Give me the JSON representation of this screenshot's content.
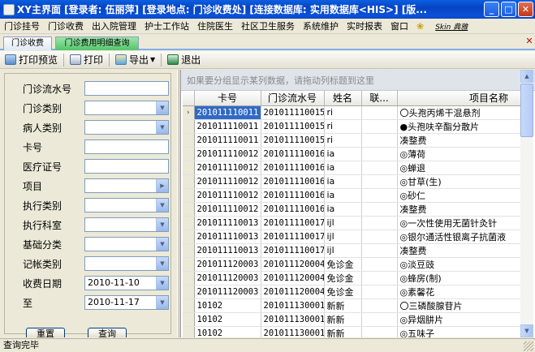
{
  "window": {
    "title": "XY主界面  [登录者: 伍丽萍]  [登录地点: 门诊收费处]  [连接数据库: 实用数据库<HIS>]  [版...",
    "minimize": "_",
    "maximize": "□",
    "close": "✕"
  },
  "menu": [
    "门诊挂号",
    "门诊收费",
    "出入院管理",
    "护士工作站",
    "住院医生",
    "社区卫生服务",
    "系统维护",
    "实时报表",
    "窗口"
  ],
  "menu_skin": "Skin 典雅",
  "tabs": [
    "门诊收费",
    "门诊费用明细查询"
  ],
  "tab_close": "✕",
  "toolbar": {
    "print_preview": "打印预览",
    "print": "打印",
    "export": "导出",
    "exit": "退出"
  },
  "filters": {
    "flow_no": {
      "label": "门诊流水号",
      "value": ""
    },
    "category": {
      "label": "门诊类别",
      "value": ""
    },
    "patient_type": {
      "label": "病人类别",
      "value": ""
    },
    "card_no": {
      "label": "卡号",
      "value": ""
    },
    "insurance_no": {
      "label": "医疗证号",
      "value": ""
    },
    "item": {
      "label": "项目",
      "value": ""
    },
    "exec_type": {
      "label": "执行类别",
      "value": ""
    },
    "exec_dept": {
      "label": "执行科室",
      "value": ""
    },
    "base_class": {
      "label": "基础分类",
      "value": ""
    },
    "account_type": {
      "label": "记帐类别",
      "value": ""
    },
    "charge_date": {
      "label": "收费日期",
      "value": "2010-11-10"
    },
    "to_date": {
      "label": "至",
      "value": "2010-11-17"
    },
    "btn_reset": "重置",
    "btn_query": "查询"
  },
  "grid": {
    "group_hint": "如果要分组显示某列数据，请拖动列标题到这里",
    "columns": [
      "卡号",
      "门诊流水号",
      "姓名",
      "联...",
      "项目名称"
    ],
    "rows": [
      [
        "201011110011",
        "201011110015",
        "ri",
        "",
        "〇头孢丙烯干混悬剂"
      ],
      [
        "201011110011",
        "201011110015",
        "ri",
        "",
        "●头孢呋辛酯分散片"
      ],
      [
        "201011110011",
        "201011110015",
        "ri",
        "",
        "凑整费"
      ],
      [
        "201011110012",
        "201011110016",
        "ia",
        "",
        "◎薄荷"
      ],
      [
        "201011110012",
        "201011110016",
        "ia",
        "",
        "◎蝉退"
      ],
      [
        "201011110012",
        "201011110016",
        "ia",
        "",
        "◎甘草(生)"
      ],
      [
        "201011110012",
        "201011110016",
        "ia",
        "",
        "◎砂仁"
      ],
      [
        "201011110012",
        "201011110016",
        "ia",
        "",
        "凑整费"
      ],
      [
        "201011110013",
        "201011110017",
        "ijl",
        "",
        "◎一次性使用无菌针灸针"
      ],
      [
        "201011110013",
        "201011110017",
        "ijl",
        "",
        "◎银尔通活性银离子抗菌液"
      ],
      [
        "201011110013",
        "201011110017",
        "ijl",
        "",
        "凑整费"
      ],
      [
        "201011120003",
        "201011120004",
        "免诊金",
        "",
        "◎淡豆豉"
      ],
      [
        "201011120003",
        "201011120004",
        "免诊金",
        "",
        "◎蜂房(制)"
      ],
      [
        "201011120003",
        "201011120004",
        "免诊金",
        "",
        "◎素馨花"
      ],
      [
        "10102",
        "201011130001",
        "新新",
        "",
        "〇三磷酸腺苷片"
      ],
      [
        "10102",
        "201011130001",
        "新新",
        "",
        "◎异烟肼片"
      ],
      [
        "10102",
        "201011130001",
        "新新",
        "",
        "◎五味子"
      ]
    ]
  },
  "status": "查询完毕",
  "colors": {
    "titlebar": "#0744c4",
    "active_tab": "#54c46a",
    "selection": "#316ac5"
  }
}
